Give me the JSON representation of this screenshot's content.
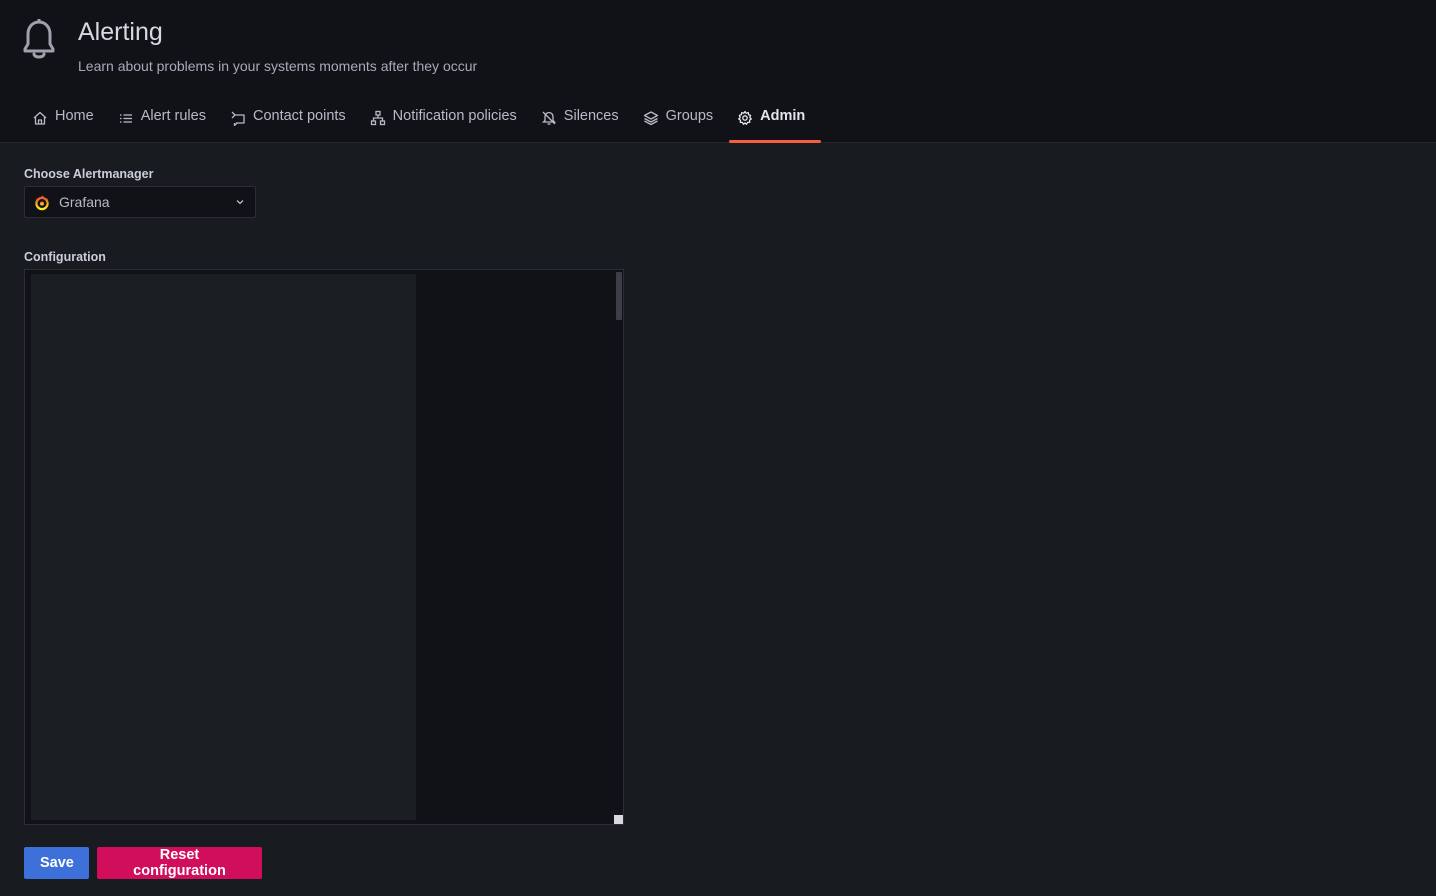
{
  "header": {
    "icon": "bell-icon",
    "title": "Alerting",
    "subtitle": "Learn about problems in your systems moments after they occur"
  },
  "tabs": [
    {
      "label": "Home",
      "icon": "home-icon",
      "active": false
    },
    {
      "label": "Alert rules",
      "icon": "list-icon",
      "active": false
    },
    {
      "label": "Contact points",
      "icon": "comment-alt-share-icon",
      "active": false
    },
    {
      "label": "Notification policies",
      "icon": "sitemap-icon",
      "active": false
    },
    {
      "label": "Silences",
      "icon": "bell-slash-icon",
      "active": false
    },
    {
      "label": "Groups",
      "icon": "layers-icon",
      "active": false
    },
    {
      "label": "Admin",
      "icon": "cog-icon",
      "active": true
    }
  ],
  "alertmanager": {
    "label": "Choose Alertmanager",
    "selected": "Grafana",
    "logo": "grafana-logo-icon"
  },
  "configuration": {
    "label": "Configuration",
    "value": ""
  },
  "actions": {
    "save_label": "Save",
    "reset_label": "Reset configuration"
  },
  "colors": {
    "accent_tab": "#f55f3e",
    "save_button": "#3d71d9",
    "reset_button": "#d10e5c",
    "header_bg": "#111217",
    "page_bg": "#181b1f"
  }
}
